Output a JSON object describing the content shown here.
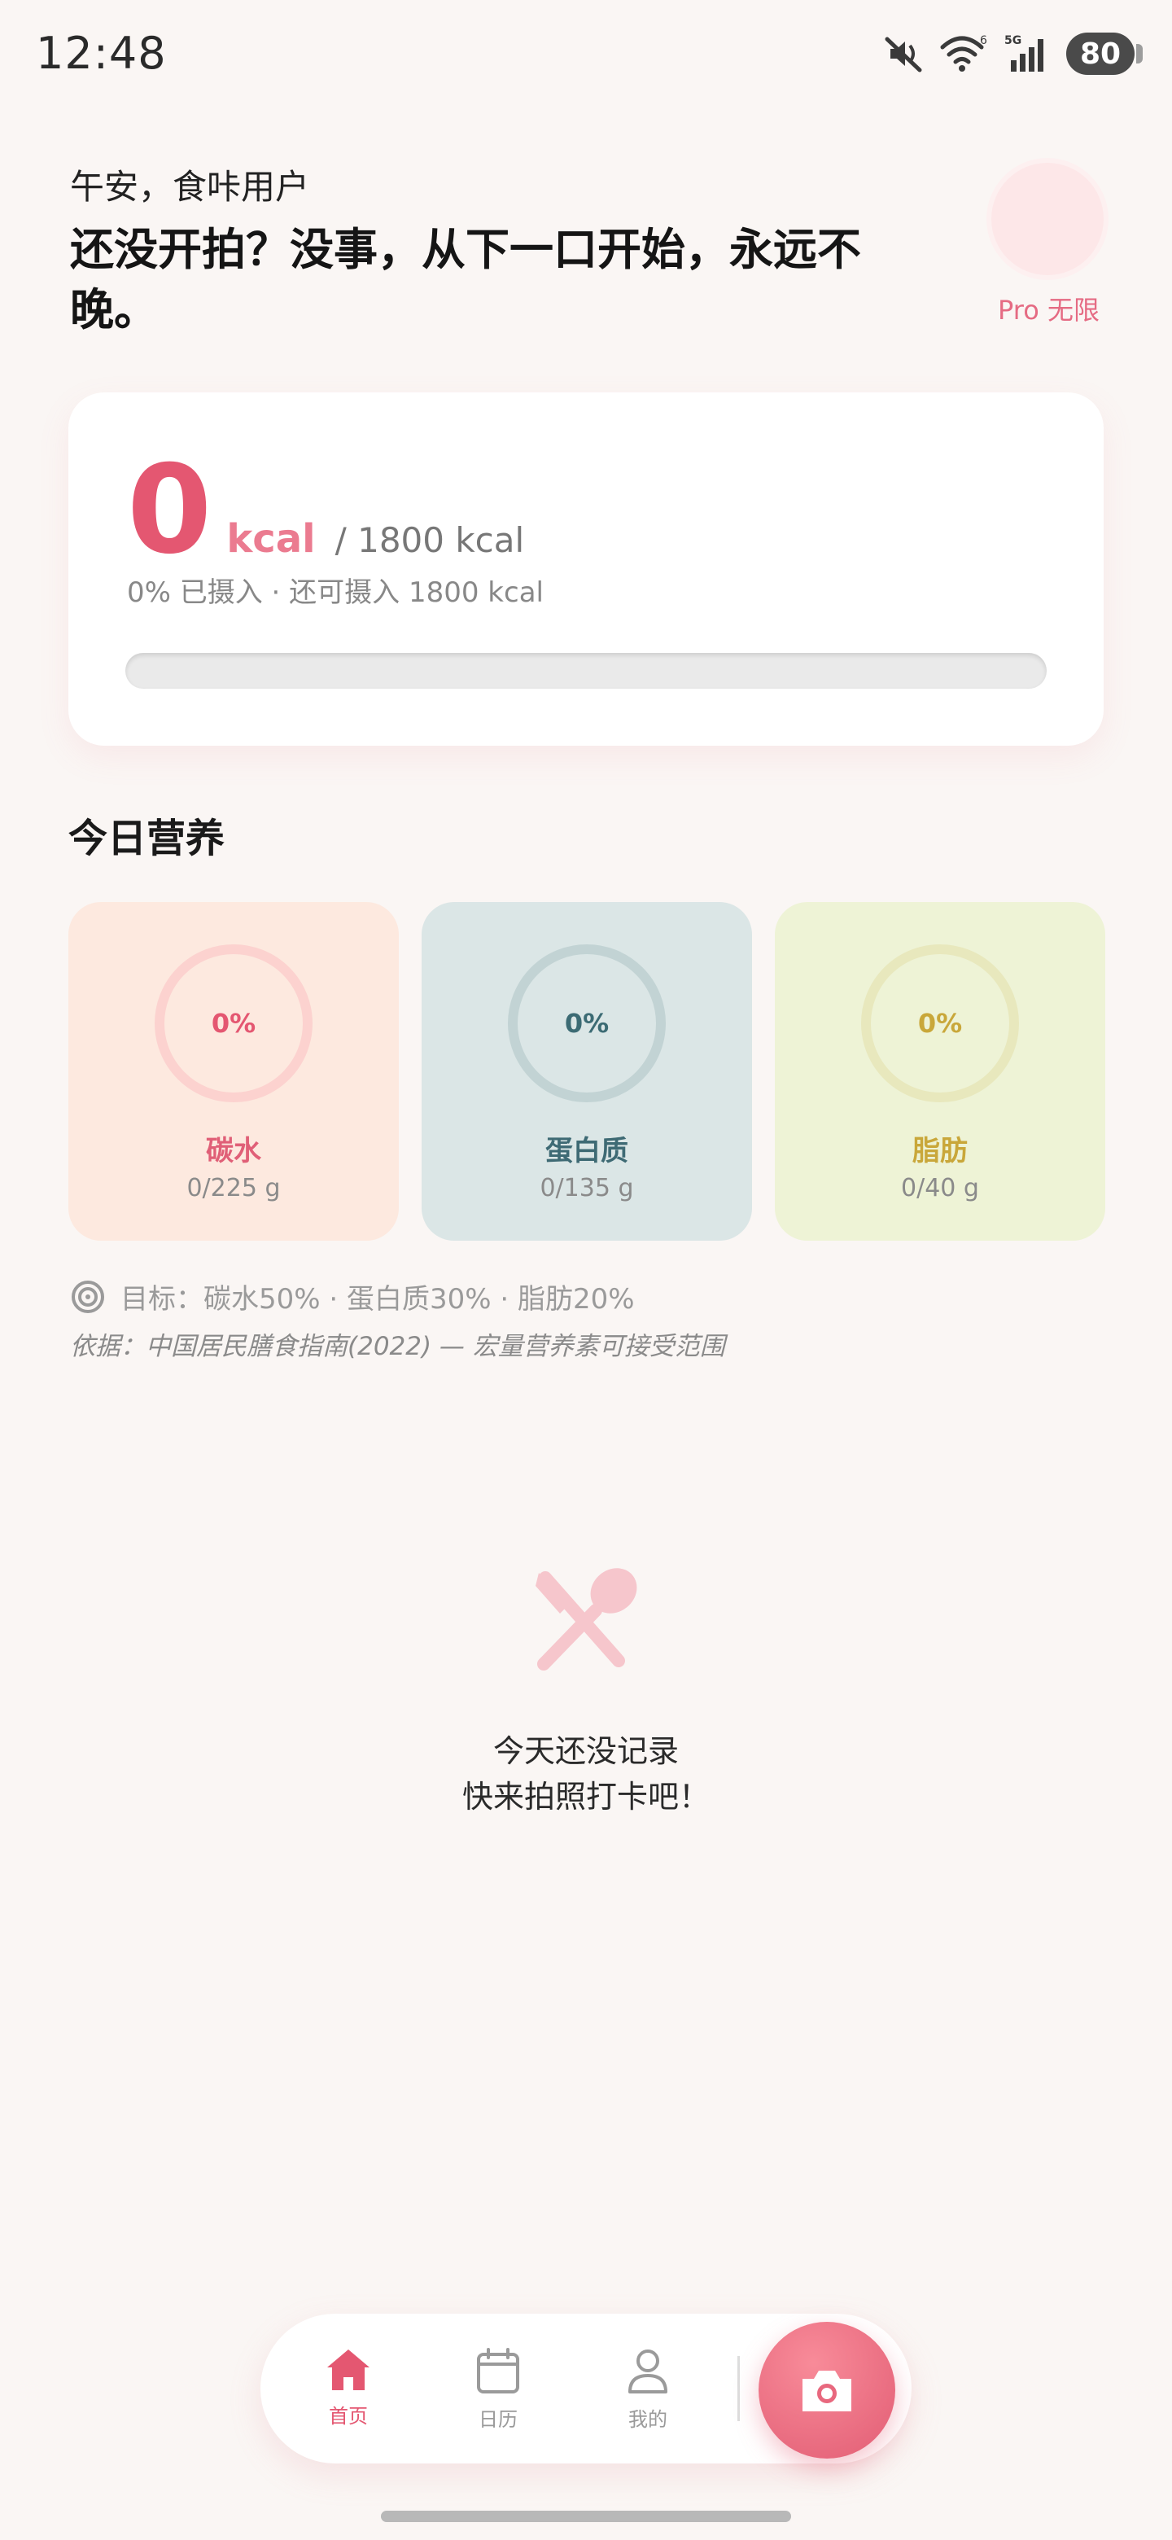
{
  "status_bar": {
    "time": "12:48",
    "icons": [
      "mute-icon",
      "wifi-icon",
      "signal-5g-icon"
    ],
    "battery": "80"
  },
  "header": {
    "greeting": "午安，食咔用户",
    "headline": "还没开拍？没事，从下一口开始，永远不晚。",
    "pro_label": "Pro 无限"
  },
  "calorie": {
    "value": "0",
    "unit": "kcal",
    "goal": "/ 1800 kcal",
    "summary": "0% 已摄入 · 还可摄入 1800 kcal",
    "progress": 0
  },
  "nutrition": {
    "title": "今日营养",
    "macros": [
      {
        "percent": "0%",
        "name": "碳水",
        "amount": "0/225 g"
      },
      {
        "percent": "0%",
        "name": "蛋白质",
        "amount": "0/135 g"
      },
      {
        "percent": "0%",
        "name": "脂肪",
        "amount": "0/40 g"
      }
    ],
    "target": "目标：碳水50% · 蛋白质30% · 脂肪20%",
    "basis": "依据：中国居民膳食指南(2022) — 宏量营养素可接受范围"
  },
  "empty_state": {
    "line1": "今天还没记录",
    "line2": "快来拍照打卡吧！"
  },
  "nav": {
    "home": "首页",
    "calendar": "日历",
    "profile": "我的"
  },
  "colors": {
    "accent": "#e45771",
    "background": "#faf6f4",
    "carb_bg": "#fde9df",
    "protein_bg": "#dbe6e6",
    "fat_bg": "#eef3d6"
  }
}
